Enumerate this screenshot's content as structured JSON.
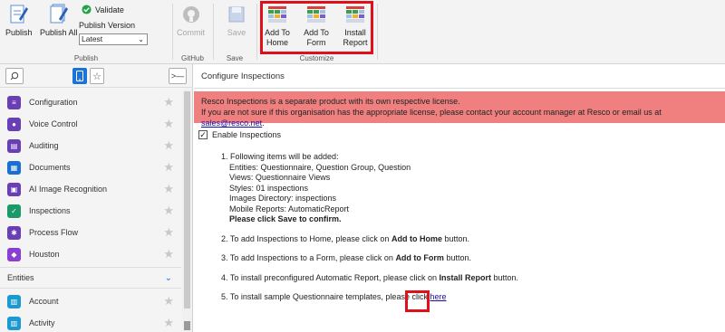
{
  "ribbon": {
    "publish": "Publish",
    "publish_all": "Publish All",
    "validate": "Validate",
    "publish_version_label": "Publish Version",
    "publish_version_value": "Latest",
    "commit": "Commit",
    "save": "Save",
    "add_to_home": "Add To Home",
    "add_to_home_l1": "Add To",
    "add_to_home_l2": "Home",
    "add_to_form_l1": "Add To",
    "add_to_form_l2": "Form",
    "install_report_l1": "Install",
    "install_report_l2": "Report",
    "groups": {
      "publish": "Publish",
      "github": "GitHub",
      "save": "Save",
      "customize": "Customize"
    },
    "accent_color": "#e0101b"
  },
  "sidebar": {
    "items": [
      {
        "label": "Configuration",
        "icon": "sliders-icon",
        "color": "#6a3fb5"
      },
      {
        "label": "Voice Control",
        "icon": "microphone-icon",
        "color": "#6a3fb5"
      },
      {
        "label": "Auditing",
        "icon": "audit-icon",
        "color": "#6a3fb5"
      },
      {
        "label": "Documents",
        "icon": "documents-icon",
        "color": "#1a6fd0"
      },
      {
        "label": "AI Image Recognition",
        "icon": "ai-icon",
        "color": "#6a3fb5"
      },
      {
        "label": "Inspections",
        "icon": "inspections-icon",
        "color": "#1a9a6a"
      },
      {
        "label": "Process Flow",
        "icon": "process-flow-icon",
        "color": "#6a3fb5"
      },
      {
        "label": "Houston",
        "icon": "houston-icon",
        "color": "#8a3fd0"
      }
    ],
    "section": "Entities",
    "entities": [
      {
        "label": "Account",
        "icon": "account-icon",
        "color": "#1a9ad0"
      },
      {
        "label": "Activity",
        "icon": "activity-icon",
        "color": "#1a9ad0"
      }
    ]
  },
  "main": {
    "title": "Configure Inspections",
    "banner_line1": "Resco Inspections is a separate product with its own respective license.",
    "banner_line2": "If you are not sure if this organisation has the appropriate license, please contact your account manager at Resco or email us at ",
    "banner_email": "sales@resco.net",
    "banner_end": ".",
    "enable_label": "Enable Inspections",
    "enable_checked": "✓",
    "step1_title": "1. Following items will be added:",
    "step1_entities": "Entities: Questionnaire, Question Group, Question",
    "step1_views": "Views: Questionnaire Views",
    "step1_styles": "Styles: 01 inspections",
    "step1_images": "Images Directory: inspections",
    "step1_reports": "Mobile Reports: AutomaticReport",
    "step1_save": "Please click Save to confirm.",
    "step2_pre": "2. To add Inspections to Home, please click on ",
    "step2_bold": "Add to Home",
    "step2_post": " button.",
    "step3_pre": "3. To add Inspections to a Form, please click on ",
    "step3_bold": "Add to Form",
    "step3_post": " button.",
    "step4_pre": "4. To install preconfigured Automatic Report, please click on ",
    "step4_bold": "Install Report",
    "step4_post": " button.",
    "step5_pre": "5. To install sample Questionnaire templates, please click ",
    "step5_link": "here"
  }
}
